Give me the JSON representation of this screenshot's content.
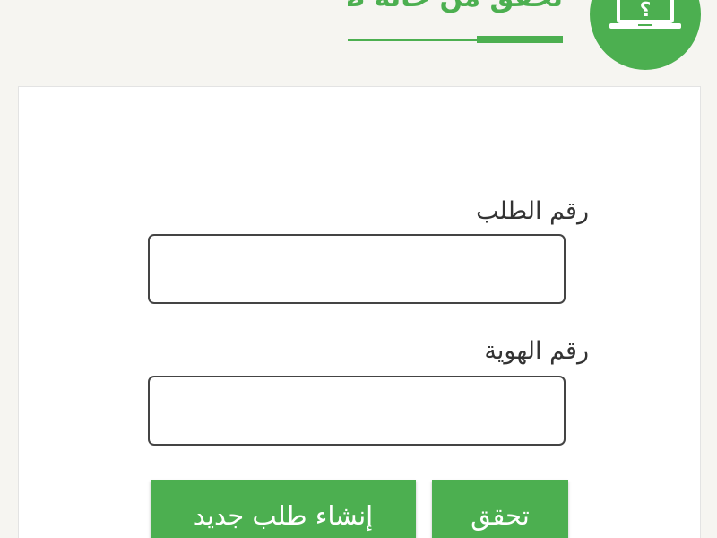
{
  "header": {
    "title": "تحقق من حالة طلبك",
    "logo_icon": "laptop-question-icon"
  },
  "form": {
    "request_number_label": "رقم الطلب",
    "request_number_value": "",
    "id_number_label": "رقم الهوية",
    "id_number_value": ""
  },
  "buttons": {
    "new_request_label": "إنشاء طلب جديد",
    "check_label": "تحقق"
  },
  "colors": {
    "brand_green": "#4caf50",
    "background": "#f6f5f1",
    "card": "#ffffff"
  }
}
